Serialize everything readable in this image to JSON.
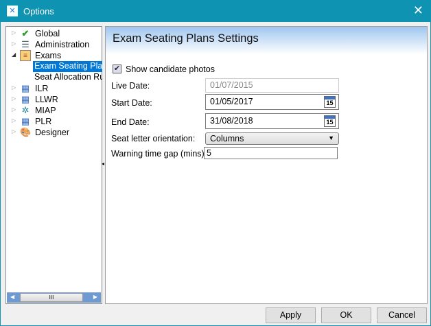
{
  "window": {
    "title": "Options",
    "close_icon": "close-icon"
  },
  "tree": {
    "items": [
      {
        "label": "Global",
        "icon": "checkmark-icon",
        "expanded": false
      },
      {
        "label": "Administration",
        "icon": "list-icon",
        "expanded": false
      },
      {
        "label": "Exams",
        "icon": "exam-icon",
        "expanded": true,
        "children": [
          {
            "label": "Exam Seating Plan",
            "selected": true
          },
          {
            "label": "Seat Allocation Ru"
          }
        ]
      },
      {
        "label": "ILR",
        "icon": "grid-icon",
        "expanded": false
      },
      {
        "label": "LLWR",
        "icon": "grid-icon",
        "expanded": false
      },
      {
        "label": "MIAP",
        "icon": "miap-icon",
        "expanded": false
      },
      {
        "label": "PLR",
        "icon": "plr-icon",
        "expanded": false
      },
      {
        "label": "Designer",
        "icon": "palette-icon",
        "expanded": false
      }
    ],
    "scroll_thumb": "III"
  },
  "settings": {
    "title": "Exam Seating Plans Settings",
    "show_photos": {
      "label": "Show candidate photos",
      "checked": true
    },
    "live_date": {
      "label": "Live Date:",
      "value": "01/07/2015"
    },
    "start_date": {
      "label": "Start Date:",
      "value": "01/05/2017",
      "cal": "15"
    },
    "end_date": {
      "label": "End Date:",
      "value": "31/08/2018",
      "cal": "15"
    },
    "orientation": {
      "label": "Seat letter orientation:",
      "value": "Columns"
    },
    "warning_gap": {
      "label": "Warning time gap (mins):",
      "value": "5"
    }
  },
  "buttons": {
    "apply": "Apply",
    "ok": "OK",
    "cancel": "Cancel"
  },
  "colors": {
    "titlebar": "#0f93b2",
    "selection": "#0078d7"
  }
}
